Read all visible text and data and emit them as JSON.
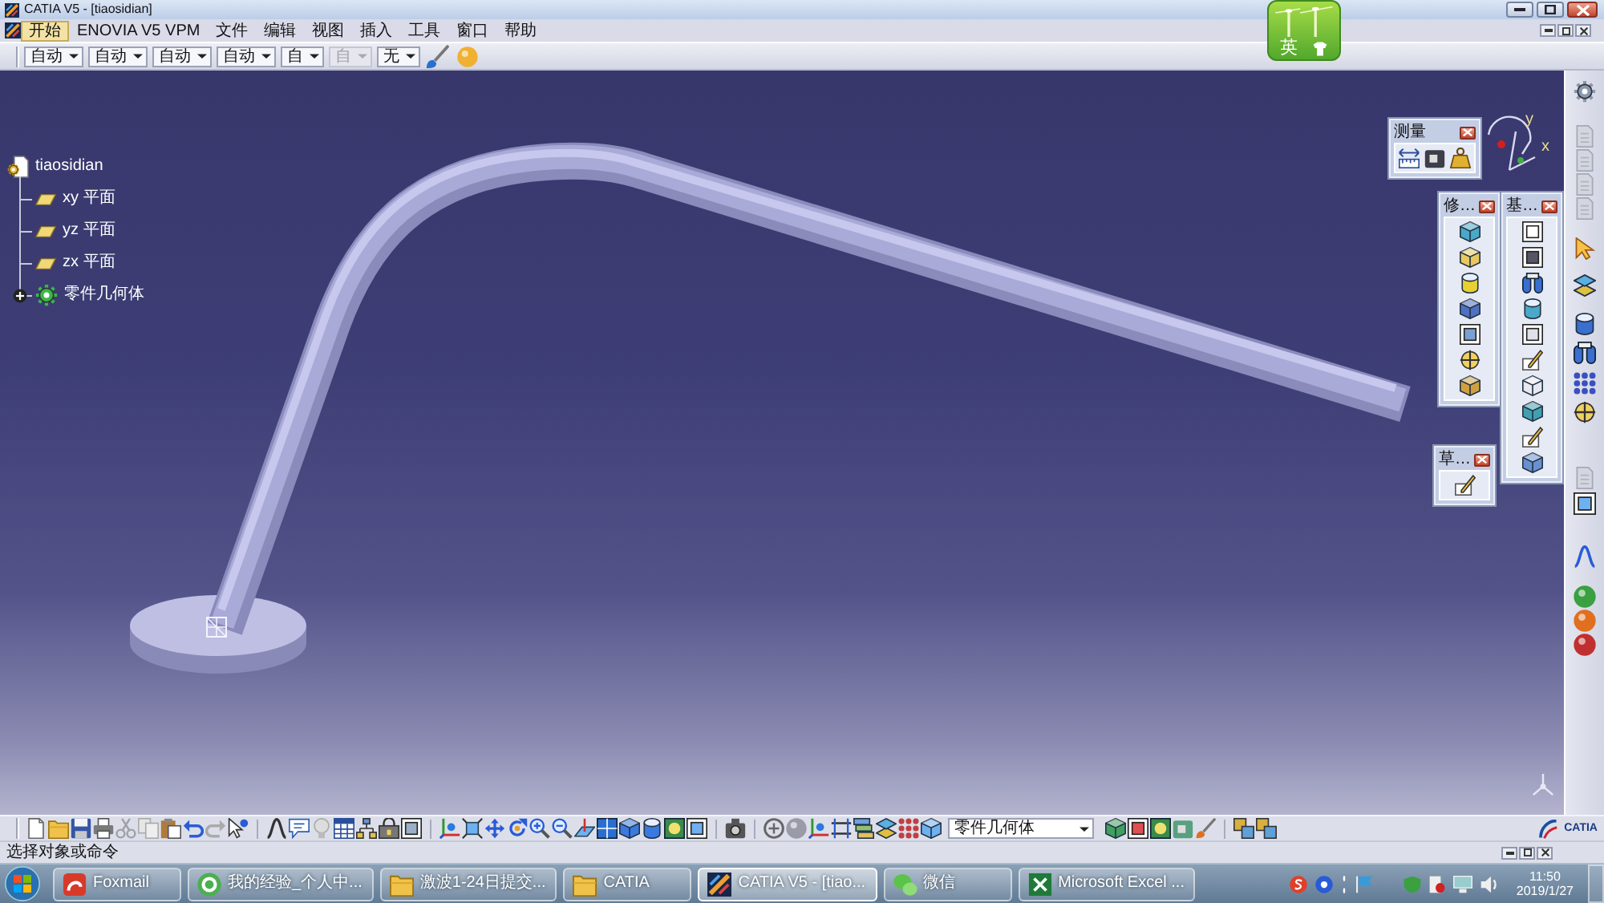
{
  "window": {
    "title": "CATIA V5 - [tiaosidian]"
  },
  "ime_bar": {
    "mode": "英"
  },
  "menu": [
    {
      "label": "开始",
      "selected": true
    },
    {
      "label": "ENOVIA V5 VPM",
      "selected": false
    },
    {
      "label": "文件",
      "selected": false
    },
    {
      "label": "编辑",
      "selected": false
    },
    {
      "label": "视图",
      "selected": false
    },
    {
      "label": "插入",
      "selected": false
    },
    {
      "label": "工具",
      "selected": false
    },
    {
      "label": "窗口",
      "selected": false
    },
    {
      "label": "帮助",
      "selected": false
    }
  ],
  "toolbar": {
    "dropdowns": [
      {
        "value": "自动",
        "disabled": false
      },
      {
        "value": "自动",
        "disabled": false
      },
      {
        "value": "自动",
        "disabled": false
      },
      {
        "value": "自动",
        "disabled": false
      },
      {
        "value": "自",
        "disabled": false
      },
      {
        "value": "自",
        "disabled": true
      },
      {
        "value": "无",
        "disabled": false
      }
    ]
  },
  "tree": {
    "label": "tiaosidian",
    "kind": "part",
    "children": [
      {
        "label": "xy 平面",
        "kind": "plane"
      },
      {
        "label": "yz 平面",
        "kind": "plane"
      },
      {
        "label": "zx 平面",
        "kind": "plane"
      },
      {
        "label": "零件几何体",
        "kind": "body",
        "expanded": false
      }
    ]
  },
  "compass": {
    "labels": [
      "y",
      "x"
    ]
  },
  "floating_toolbars": [
    {
      "title": "测量"
    },
    {
      "title": "修…"
    },
    {
      "title": "基…"
    },
    {
      "title": "草…"
    }
  ],
  "bottom_toolbar": {
    "current_body": "零件几何体"
  },
  "logo": {
    "text": "CATIA"
  },
  "status_bar": {
    "message": "选择对象或命令"
  },
  "taskbar": {
    "items": [
      {
        "label": "Foxmail",
        "kind": "mail",
        "selected": false
      },
      {
        "label": "我的经验_个人中...",
        "kind": "browser",
        "selected": false
      },
      {
        "label": "激波1-24日提交...",
        "kind": "folder",
        "selected": false
      },
      {
        "label": "CATIA",
        "kind": "folder",
        "selected": false
      },
      {
        "label": "CATIA V5 - [tiao...",
        "kind": "catia",
        "selected": true
      },
      {
        "label": "微信",
        "kind": "chat",
        "selected": false
      },
      {
        "label": "Microsoft Excel ...",
        "kind": "spreadsheet",
        "selected": false
      }
    ],
    "clock": {
      "time": "11:50",
      "date": "2019/1/27"
    }
  }
}
